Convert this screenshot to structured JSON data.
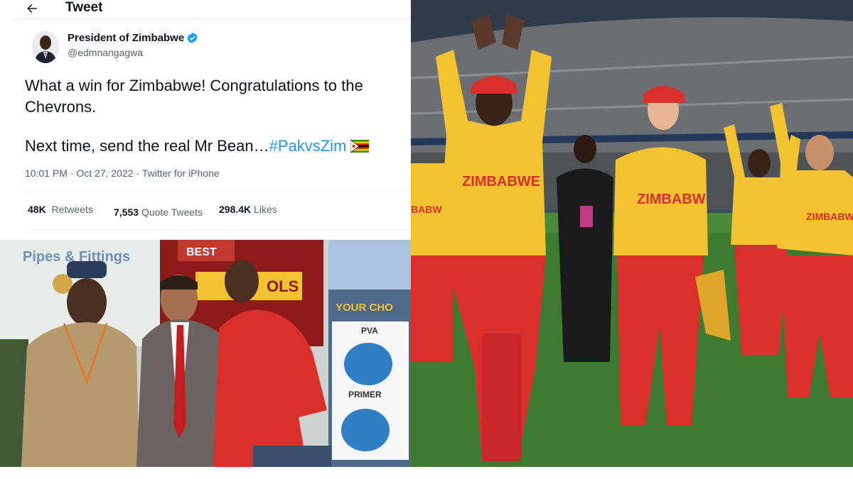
{
  "header": {
    "title": "Tweet"
  },
  "author": {
    "name": "President of Zimbabwe",
    "handle": "@edmnangagwa"
  },
  "tweet": {
    "line1": "What a win for Zimbabwe! Congratulations to the",
    "line2": "Chevrons.",
    "line3": "Next time, send the real Mr Bean…",
    "hashtag": "#PakvsZim",
    "timestamp": "10:01 PM · Oct 27, 2022 · Twitter for iPhone"
  },
  "stats": {
    "retweets_count": "48K",
    "retweets_label": "Retweets",
    "quote_count": "7,553",
    "quote_label": "Quote Tweets",
    "likes_count": "298.4K",
    "likes_label": "Likes"
  },
  "signage": {
    "pipes": "Pipes & Fittings",
    "best": "BEST",
    "tools": "OLS",
    "your_choice": "YOUR CHO",
    "pva": "PVA",
    "primer": "PRIMER"
  },
  "jerseys": {
    "front": "ZIMBABWE",
    "center": "ZIMBABW",
    "left": "BABWE",
    "right": "ZIMBABWE"
  },
  "colors": {
    "link": "#1d9bf0",
    "verified": "#1d9bf0",
    "text": "#0f1419",
    "muted": "#536471",
    "jersey_yellow": "#f2c230",
    "jersey_red": "#d9302c",
    "pitch_green": "#3f7a31"
  },
  "icons": {
    "back": "arrow-left-icon",
    "verified": "verified-badge-icon",
    "flag": "zimbabwe-flag-icon"
  }
}
